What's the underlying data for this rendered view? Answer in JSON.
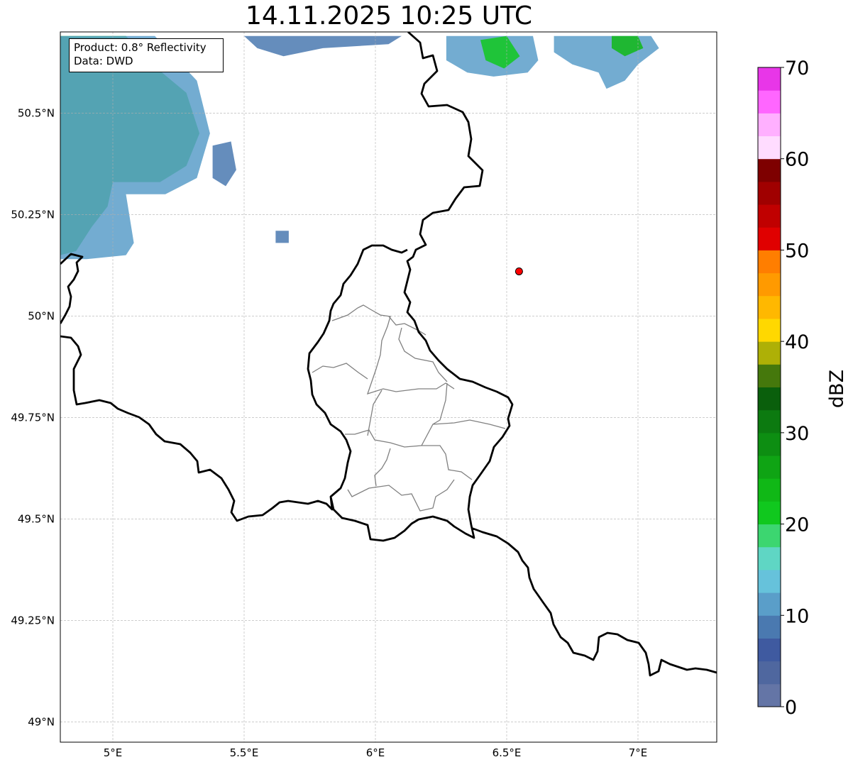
{
  "title": "14.11.2025 10:25 UTC",
  "info_box": {
    "product_line": "Product: 0.8° Reflectivity",
    "data_line": "Data: DWD"
  },
  "map": {
    "lon_range": [
      4.8,
      7.3
    ],
    "lat_range": [
      48.95,
      50.7
    ],
    "lon_ticks": [
      5.0,
      5.5,
      6.0,
      6.5,
      7.0
    ],
    "lon_tick_labels": [
      "5°E",
      "5.5°E",
      "6°E",
      "6.5°E",
      "7°E"
    ],
    "lat_ticks": [
      49.0,
      49.25,
      49.5,
      49.75,
      50.0,
      50.25,
      50.5
    ],
    "lat_tick_labels": [
      "49°N",
      "49.25°N",
      "49.5°N",
      "49.75°N",
      "50°N",
      "50.25°N",
      "50.5°N"
    ],
    "grid": true,
    "radar_site": {
      "lon": 6.547,
      "lat": 50.11,
      "color": "#ff0000"
    },
    "national_border_color": "#000000",
    "district_border_color": "#808080"
  },
  "colorbar": {
    "label": "dBZ",
    "range": [
      0,
      70
    ],
    "step": 2.5,
    "tick_values": [
      0,
      10,
      20,
      30,
      40,
      50,
      60,
      70
    ],
    "tick_labels": [
      "0",
      "10",
      "20",
      "30",
      "40",
      "50",
      "60",
      "70"
    ],
    "colors": [
      "#6475a6",
      "#4f679f",
      "#3f5aa0",
      "#4a79b0",
      "#5a9ec9",
      "#66c2db",
      "#5fd6c4",
      "#3cd670",
      "#10c81e",
      "#10b816",
      "#0fa414",
      "#0d8e12",
      "#0c7a10",
      "#0a5f0c",
      "#45780c",
      "#aeb006",
      "#ffd800",
      "#ffb800",
      "#ff9a00",
      "#ff7e00",
      "#e00000",
      "#c00000",
      "#a00000",
      "#7e0000",
      "#ffdcff",
      "#ffb0ff",
      "#ff66ff",
      "#e836e8"
    ]
  },
  "radar_echoes": [
    {
      "name": "west-band",
      "color": "#10b816",
      "polygon": [
        [
          4.8,
          50.69
        ],
        [
          5.05,
          50.69
        ],
        [
          5.15,
          50.62
        ],
        [
          5.28,
          50.55
        ],
        [
          5.33,
          50.45
        ],
        [
          5.28,
          50.37
        ],
        [
          5.18,
          50.33
        ],
        [
          5.0,
          50.33
        ],
        [
          4.98,
          50.27
        ],
        [
          4.92,
          50.22
        ],
        [
          4.86,
          50.16
        ],
        [
          4.8,
          50.15
        ]
      ]
    },
    {
      "name": "west-band-edge",
      "color": "#5a9ec9",
      "polygon": [
        [
          4.8,
          50.69
        ],
        [
          5.16,
          50.69
        ],
        [
          5.32,
          50.58
        ],
        [
          5.37,
          50.45
        ],
        [
          5.32,
          50.34
        ],
        [
          5.2,
          50.3
        ],
        [
          5.05,
          50.3
        ],
        [
          5.08,
          50.18
        ],
        [
          5.05,
          50.15
        ],
        [
          4.9,
          50.14
        ],
        [
          4.8,
          50.14
        ]
      ]
    },
    {
      "name": "north-east-cell-a",
      "color": "#5a9ec9",
      "polygon": [
        [
          6.27,
          50.69
        ],
        [
          6.6,
          50.69
        ],
        [
          6.62,
          50.63
        ],
        [
          6.58,
          50.6
        ],
        [
          6.45,
          50.59
        ],
        [
          6.35,
          50.6
        ],
        [
          6.27,
          50.63
        ]
      ]
    },
    {
      "name": "north-east-cell-a-core",
      "color": "#10c81e",
      "polygon": [
        [
          6.4,
          50.68
        ],
        [
          6.5,
          50.69
        ],
        [
          6.55,
          50.64
        ],
        [
          6.49,
          50.61
        ],
        [
          6.42,
          50.63
        ]
      ]
    },
    {
      "name": "north-east-cell-b",
      "color": "#5a9ec9",
      "polygon": [
        [
          6.68,
          50.69
        ],
        [
          7.05,
          50.69
        ],
        [
          7.08,
          50.66
        ],
        [
          7.0,
          50.62
        ],
        [
          6.95,
          50.58
        ],
        [
          6.88,
          50.56
        ],
        [
          6.85,
          50.6
        ],
        [
          6.75,
          50.62
        ],
        [
          6.68,
          50.65
        ]
      ]
    },
    {
      "name": "north-east-cell-b-core",
      "color": "#10b816",
      "polygon": [
        [
          6.9,
          50.69
        ],
        [
          7.0,
          50.69
        ],
        [
          7.02,
          50.66
        ],
        [
          6.95,
          50.64
        ],
        [
          6.9,
          50.66
        ]
      ]
    },
    {
      "name": "small-cell-a",
      "color": "#4a79b0",
      "polygon": [
        [
          5.38,
          50.42
        ],
        [
          5.45,
          50.43
        ],
        [
          5.47,
          50.36
        ],
        [
          5.43,
          50.32
        ],
        [
          5.38,
          50.34
        ]
      ]
    },
    {
      "name": "small-cell-b",
      "color": "#4a79b0",
      "polygon": [
        [
          5.62,
          50.21
        ],
        [
          5.67,
          50.21
        ],
        [
          5.67,
          50.18
        ],
        [
          5.62,
          50.18
        ]
      ]
    },
    {
      "name": "north-strip",
      "color": "#4a79b0",
      "polygon": [
        [
          5.5,
          50.69
        ],
        [
          6.1,
          50.69
        ],
        [
          6.05,
          50.67
        ],
        [
          5.8,
          50.66
        ],
        [
          5.65,
          50.64
        ],
        [
          5.55,
          50.66
        ]
      ]
    }
  ]
}
